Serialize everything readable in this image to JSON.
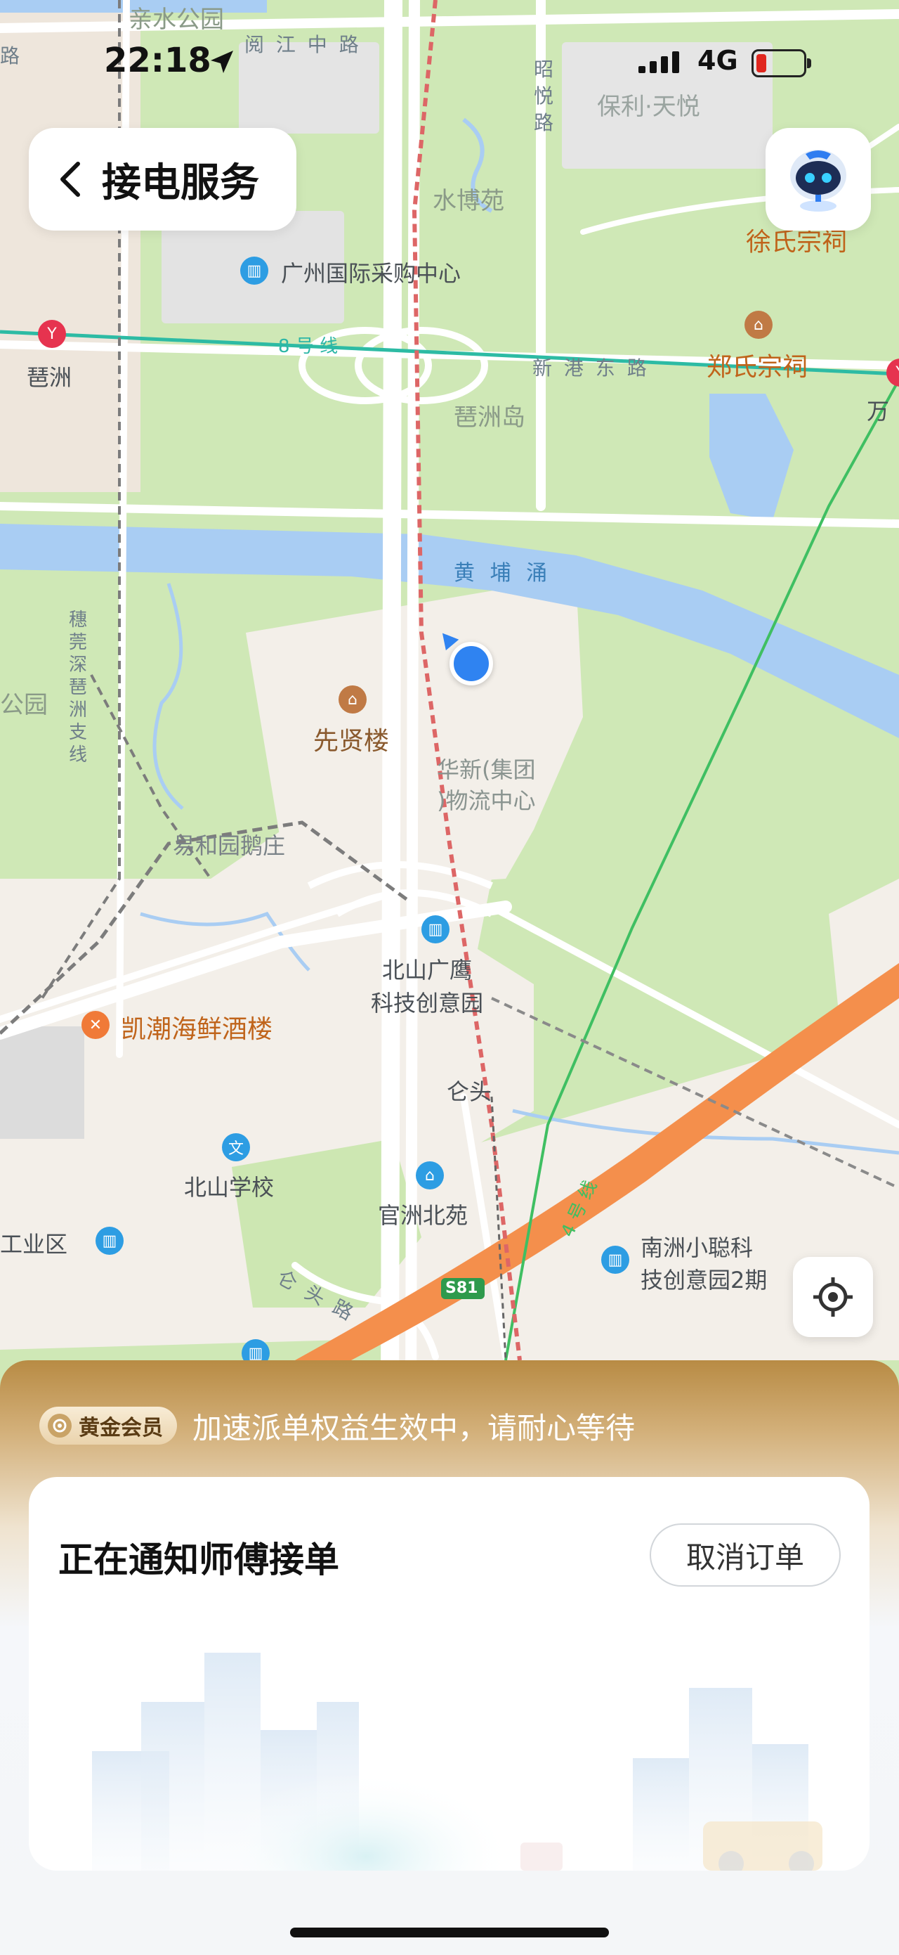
{
  "status_bar": {
    "time": "22:18",
    "network": "4G"
  },
  "header": {
    "title": "接电服务"
  },
  "map": {
    "labels": {
      "qinshui_park": "亲水公园",
      "road_left": "路",
      "yuejiang_road": "阅 江 中 路",
      "zhaoyue_road": "昭 悦 路",
      "poly_tianyue": "保利·天悦",
      "shuiboyuan": "水博苑",
      "guangzhou_purchasing": "广州国际采购中心",
      "line8": "8 号 线",
      "pazhou_station": "琶洲",
      "xingang_road": "新 港 东 路",
      "zheng_ancestral": "郑氏宗祠",
      "xu_ancestral": "徐氏宗祠",
      "wan_label": "万",
      "pazhou_island": "琶洲岛",
      "huangpu_chong": "黄 埔 涌",
      "suiguan_line": "穗 莞 深 琶 洲 支 线",
      "gongyuan": "公园",
      "xianxianlou": "先贤楼",
      "huaxin_logistics_1": "华新(集团",
      "huaxin_logistics_2": ")物流中心",
      "yiheyuan": "易和园鹅庄",
      "beishan_park_1": "北山广鹰",
      "beishan_park_2": "科技创意园",
      "kaichao_restaurant": "凯潮海鲜酒楼",
      "cangtou": "仑头",
      "beishan_school": "北山学校",
      "guanzhou_beiyuan": "官洲北苑",
      "industrial_zone": "工业区",
      "cangtou_road": "仑 头 路",
      "s81": "S81",
      "line4": "4 号 线",
      "nanzhou_park_1": "南洲小聪科",
      "nanzhou_park_2": "技创意园2期"
    }
  },
  "bottom_sheet": {
    "member_badge": "黄金会员",
    "member_message": "加速派单权益生效中，请耐心等待",
    "status_title": "正在通知师傅接单",
    "cancel_button": "取消订单"
  }
}
